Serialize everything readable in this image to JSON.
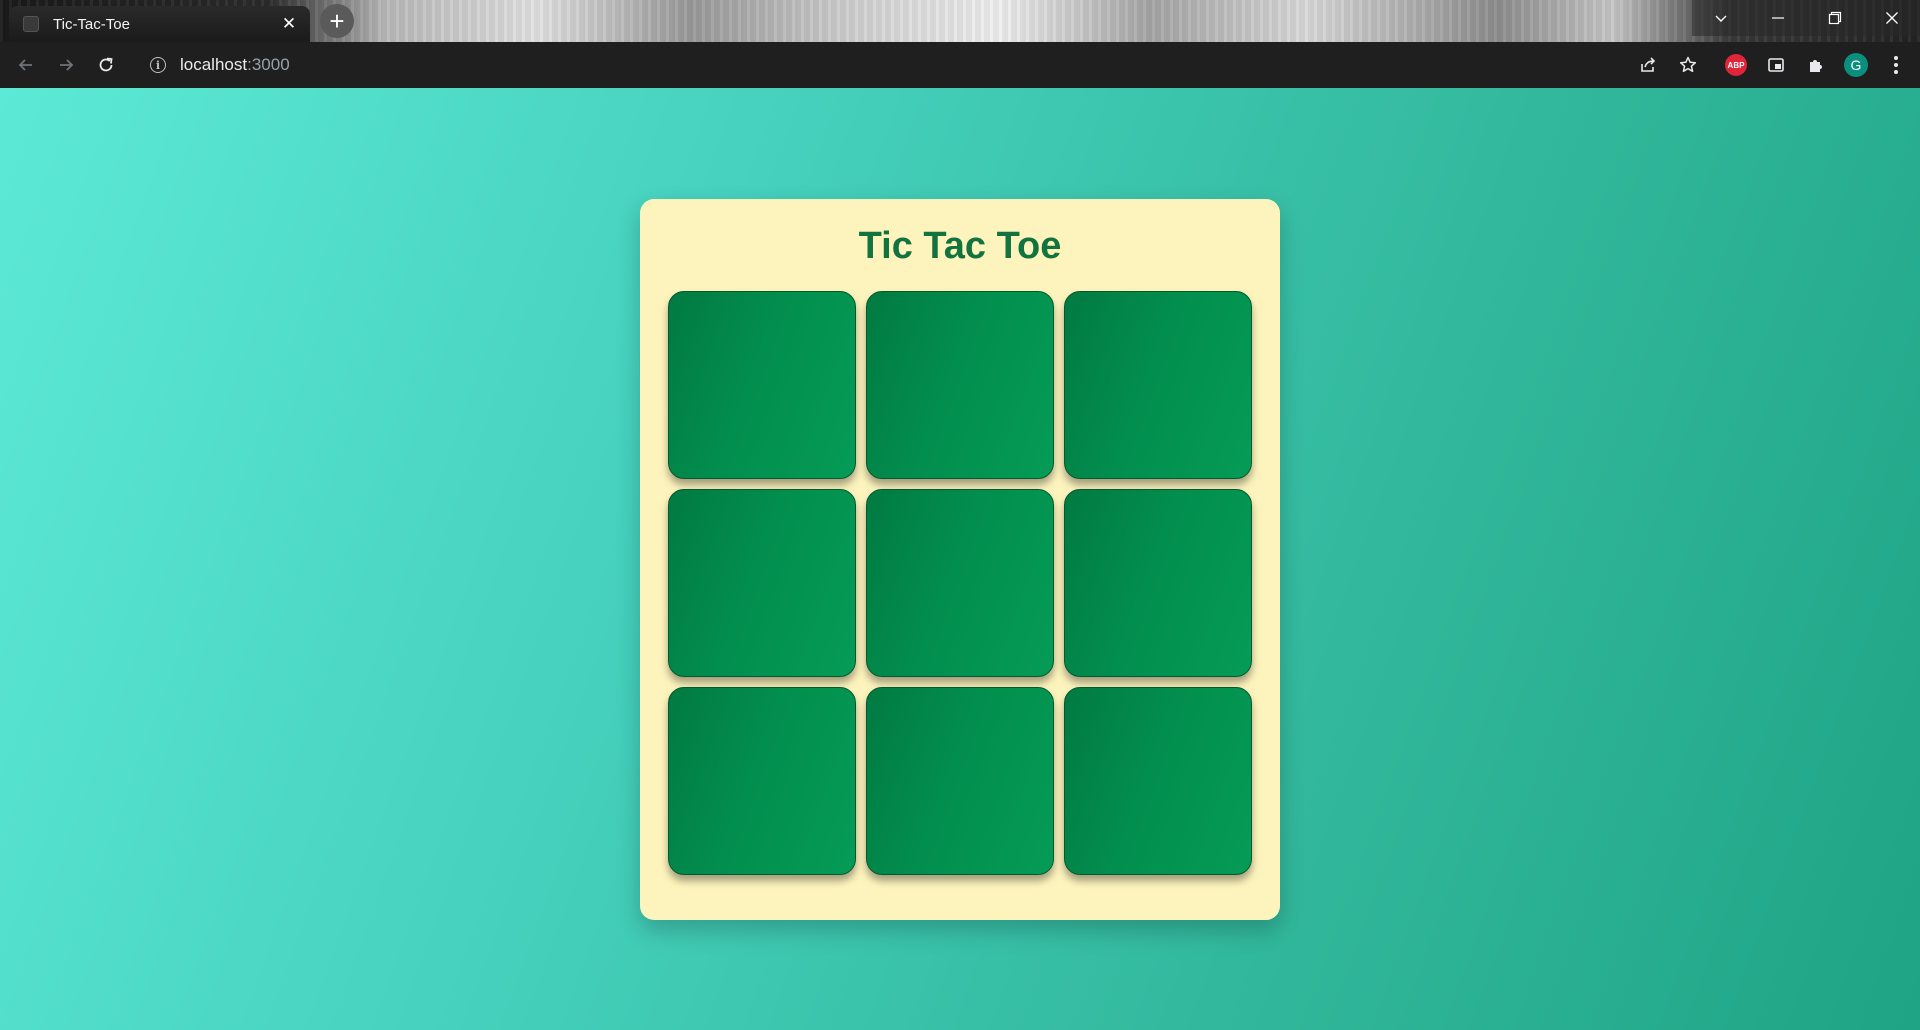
{
  "browser": {
    "tab": {
      "title": "Tic-Tac-Toe",
      "close_glyph": "✕"
    },
    "new_tab_glyph": "+",
    "address": {
      "host": "localhost",
      "port": ":3000"
    },
    "extensions": {
      "abp_label": "ABP"
    },
    "profile_initial": "G"
  },
  "colors": {
    "background_start": "#5ce9d6",
    "background_end": "#1fa485",
    "card": "#fdf4bd",
    "title": "#13733f",
    "cell": "#028e4e"
  },
  "game": {
    "title": "Tic Tac Toe",
    "board": [
      {
        "mark": ""
      },
      {
        "mark": ""
      },
      {
        "mark": ""
      },
      {
        "mark": ""
      },
      {
        "mark": ""
      },
      {
        "mark": ""
      },
      {
        "mark": ""
      },
      {
        "mark": ""
      },
      {
        "mark": ""
      }
    ]
  }
}
